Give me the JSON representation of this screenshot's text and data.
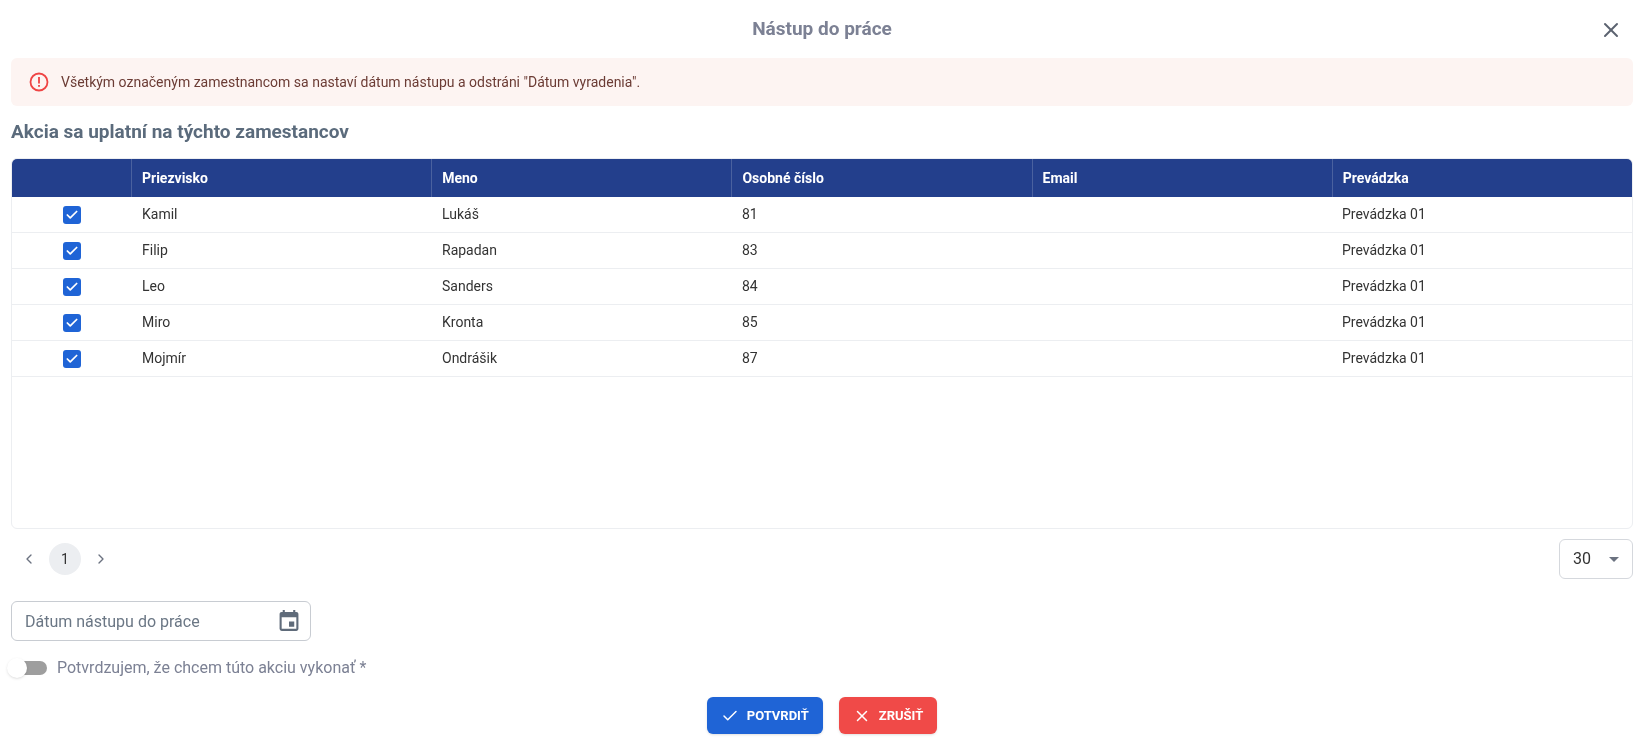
{
  "dialog": {
    "title": "Nástup do práce"
  },
  "alert": {
    "text": "Všetkým označeným zamestnancom sa nastaví dátum nástupu a odstráni \"Dátum vyradenia\"."
  },
  "section_title": "Akcia sa uplatní na týchto zamestancov",
  "table": {
    "columns": [
      "Priezvisko",
      "Meno",
      "Osobné číslo",
      "Email",
      "Prevádzka"
    ],
    "rows": [
      {
        "checked": true,
        "cells": [
          "Kamil",
          "Lukáš",
          "81",
          "",
          "Prevádzka 01"
        ]
      },
      {
        "checked": true,
        "cells": [
          "Filip",
          "Rapadan",
          "83",
          "",
          "Prevádzka 01"
        ]
      },
      {
        "checked": true,
        "cells": [
          "Leo",
          "Sanders",
          "84",
          "",
          "Prevádzka 01"
        ]
      },
      {
        "checked": true,
        "cells": [
          "Miro",
          "Kronta",
          "85",
          "",
          "Prevádzka 01"
        ]
      },
      {
        "checked": true,
        "cells": [
          "Mojmír",
          "Ondrášik",
          "87",
          "",
          "Prevádzka 01"
        ]
      }
    ]
  },
  "pagination": {
    "pages": [
      {
        "label": "1",
        "selected": true
      }
    ],
    "page_size": "30"
  },
  "date_field": {
    "placeholder": "Dátum nástupu do práce"
  },
  "confirm_switch": {
    "label": "Potvrdzujem, že chcem túto akciu vykonať *",
    "on": false
  },
  "buttons": [
    {
      "kind": "confirm",
      "label": "POTVRDIŤ"
    },
    {
      "kind": "cancel",
      "label": "ZRUŠIŤ"
    }
  ]
}
